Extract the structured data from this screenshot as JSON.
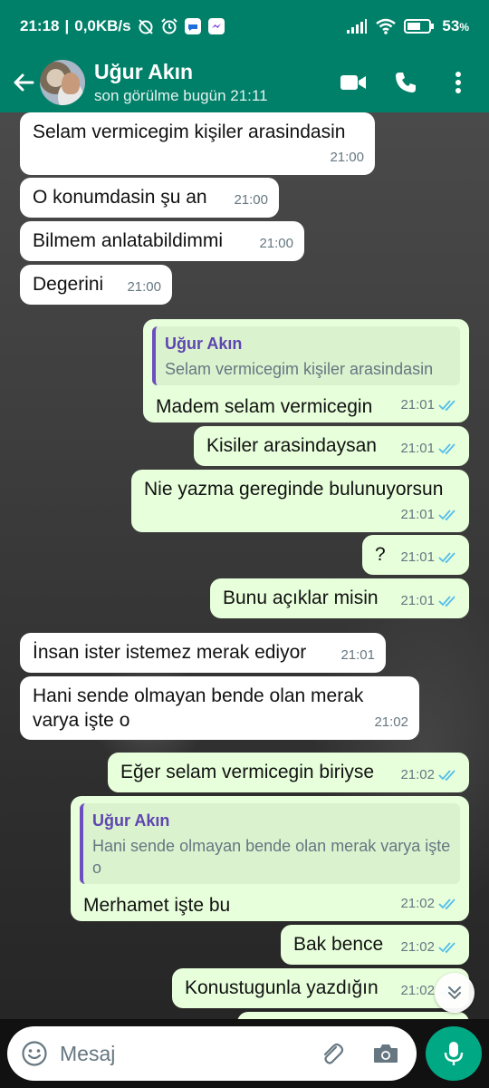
{
  "status_bar": {
    "time": "21:18",
    "net_speed": "0,0KB/s",
    "battery": "53",
    "battery_unit": "%"
  },
  "header": {
    "contact_name": "Uğur Akın",
    "last_seen": "son görülme bugün 21:11"
  },
  "messages": [
    {
      "dir": "in",
      "text": "Selam vermicegim kişiler arasindasin",
      "time": "21:00"
    },
    {
      "dir": "in",
      "text": "O konumdasin şu an",
      "time": "21:00"
    },
    {
      "dir": "in",
      "text": "Bilmem anlatabildimmi",
      "time": "21:00"
    },
    {
      "dir": "in",
      "text": "Degerini",
      "time": "21:00"
    },
    {
      "dir": "out",
      "quote_author": "Uğur Akın",
      "quote_text": "Selam vermicegim kişiler arasindasin",
      "text": "Madem selam vermicegin",
      "time": "21:01"
    },
    {
      "dir": "out",
      "text": "Kisiler arasindaysan",
      "time": "21:01"
    },
    {
      "dir": "out",
      "text": "Nie yazma gereginde bulunuyorsun",
      "time": "21:01"
    },
    {
      "dir": "out",
      "text": "?",
      "time": "21:01"
    },
    {
      "dir": "out",
      "text": "Bunu açıklar misin",
      "time": "21:01"
    },
    {
      "dir": "in",
      "text": "İnsan ister istemez merak ediyor",
      "time": "21:01"
    },
    {
      "dir": "in",
      "text": "Hani sende olmayan bende olan merak varya işte o",
      "time": "21:02"
    },
    {
      "dir": "out",
      "text": "Eğer selam vermicegin biriyse",
      "time": "21:02"
    },
    {
      "dir": "out",
      "quote_author": "Uğur Akın",
      "quote_text": "Hani sende olmayan bende olan merak varya işte o",
      "text": "Merhamet işte bu",
      "time": "21:02"
    },
    {
      "dir": "out",
      "text": "Bak bence",
      "time": "21:02"
    },
    {
      "dir": "out",
      "text": "Konustugunla yazdığın",
      "time": "21:02"
    }
  ],
  "composer": {
    "placeholder": "Mesaj"
  },
  "icons": {
    "back": "arrow-left-icon",
    "video": "video-call-icon",
    "call": "phone-icon",
    "menu": "more-vert-icon",
    "emoji": "emoji-icon",
    "attach": "paperclip-icon",
    "camera": "camera-icon",
    "mic": "mic-icon",
    "scroll": "double-chevron-down-icon"
  },
  "colors": {
    "header": "#008069",
    "incoming_bubble": "#ffffff",
    "outgoing_bubble": "#e7ffdb",
    "read_tick": "#53bdeb",
    "accent": "#00a884"
  }
}
